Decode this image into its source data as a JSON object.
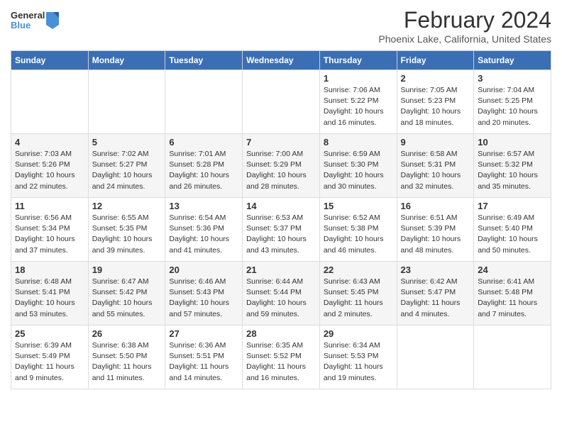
{
  "logo": {
    "line1": "General",
    "line2": "Blue"
  },
  "title": "February 2024",
  "subtitle": "Phoenix Lake, California, United States",
  "days_of_week": [
    "Sunday",
    "Monday",
    "Tuesday",
    "Wednesday",
    "Thursday",
    "Friday",
    "Saturday"
  ],
  "weeks": [
    [
      {
        "day": "",
        "info": ""
      },
      {
        "day": "",
        "info": ""
      },
      {
        "day": "",
        "info": ""
      },
      {
        "day": "",
        "info": ""
      },
      {
        "day": "1",
        "info": "Sunrise: 7:06 AM\nSunset: 5:22 PM\nDaylight: 10 hours\nand 16 minutes."
      },
      {
        "day": "2",
        "info": "Sunrise: 7:05 AM\nSunset: 5:23 PM\nDaylight: 10 hours\nand 18 minutes."
      },
      {
        "day": "3",
        "info": "Sunrise: 7:04 AM\nSunset: 5:25 PM\nDaylight: 10 hours\nand 20 minutes."
      }
    ],
    [
      {
        "day": "4",
        "info": "Sunrise: 7:03 AM\nSunset: 5:26 PM\nDaylight: 10 hours\nand 22 minutes."
      },
      {
        "day": "5",
        "info": "Sunrise: 7:02 AM\nSunset: 5:27 PM\nDaylight: 10 hours\nand 24 minutes."
      },
      {
        "day": "6",
        "info": "Sunrise: 7:01 AM\nSunset: 5:28 PM\nDaylight: 10 hours\nand 26 minutes."
      },
      {
        "day": "7",
        "info": "Sunrise: 7:00 AM\nSunset: 5:29 PM\nDaylight: 10 hours\nand 28 minutes."
      },
      {
        "day": "8",
        "info": "Sunrise: 6:59 AM\nSunset: 5:30 PM\nDaylight: 10 hours\nand 30 minutes."
      },
      {
        "day": "9",
        "info": "Sunrise: 6:58 AM\nSunset: 5:31 PM\nDaylight: 10 hours\nand 32 minutes."
      },
      {
        "day": "10",
        "info": "Sunrise: 6:57 AM\nSunset: 5:32 PM\nDaylight: 10 hours\nand 35 minutes."
      }
    ],
    [
      {
        "day": "11",
        "info": "Sunrise: 6:56 AM\nSunset: 5:34 PM\nDaylight: 10 hours\nand 37 minutes."
      },
      {
        "day": "12",
        "info": "Sunrise: 6:55 AM\nSunset: 5:35 PM\nDaylight: 10 hours\nand 39 minutes."
      },
      {
        "day": "13",
        "info": "Sunrise: 6:54 AM\nSunset: 5:36 PM\nDaylight: 10 hours\nand 41 minutes."
      },
      {
        "day": "14",
        "info": "Sunrise: 6:53 AM\nSunset: 5:37 PM\nDaylight: 10 hours\nand 43 minutes."
      },
      {
        "day": "15",
        "info": "Sunrise: 6:52 AM\nSunset: 5:38 PM\nDaylight: 10 hours\nand 46 minutes."
      },
      {
        "day": "16",
        "info": "Sunrise: 6:51 AM\nSunset: 5:39 PM\nDaylight: 10 hours\nand 48 minutes."
      },
      {
        "day": "17",
        "info": "Sunrise: 6:49 AM\nSunset: 5:40 PM\nDaylight: 10 hours\nand 50 minutes."
      }
    ],
    [
      {
        "day": "18",
        "info": "Sunrise: 6:48 AM\nSunset: 5:41 PM\nDaylight: 10 hours\nand 53 minutes."
      },
      {
        "day": "19",
        "info": "Sunrise: 6:47 AM\nSunset: 5:42 PM\nDaylight: 10 hours\nand 55 minutes."
      },
      {
        "day": "20",
        "info": "Sunrise: 6:46 AM\nSunset: 5:43 PM\nDaylight: 10 hours\nand 57 minutes."
      },
      {
        "day": "21",
        "info": "Sunrise: 6:44 AM\nSunset: 5:44 PM\nDaylight: 10 hours\nand 59 minutes."
      },
      {
        "day": "22",
        "info": "Sunrise: 6:43 AM\nSunset: 5:45 PM\nDaylight: 11 hours\nand 2 minutes."
      },
      {
        "day": "23",
        "info": "Sunrise: 6:42 AM\nSunset: 5:47 PM\nDaylight: 11 hours\nand 4 minutes."
      },
      {
        "day": "24",
        "info": "Sunrise: 6:41 AM\nSunset: 5:48 PM\nDaylight: 11 hours\nand 7 minutes."
      }
    ],
    [
      {
        "day": "25",
        "info": "Sunrise: 6:39 AM\nSunset: 5:49 PM\nDaylight: 11 hours\nand 9 minutes."
      },
      {
        "day": "26",
        "info": "Sunrise: 6:38 AM\nSunset: 5:50 PM\nDaylight: 11 hours\nand 11 minutes."
      },
      {
        "day": "27",
        "info": "Sunrise: 6:36 AM\nSunset: 5:51 PM\nDaylight: 11 hours\nand 14 minutes."
      },
      {
        "day": "28",
        "info": "Sunrise: 6:35 AM\nSunset: 5:52 PM\nDaylight: 11 hours\nand 16 minutes."
      },
      {
        "day": "29",
        "info": "Sunrise: 6:34 AM\nSunset: 5:53 PM\nDaylight: 11 hours\nand 19 minutes."
      },
      {
        "day": "",
        "info": ""
      },
      {
        "day": "",
        "info": ""
      }
    ]
  ]
}
